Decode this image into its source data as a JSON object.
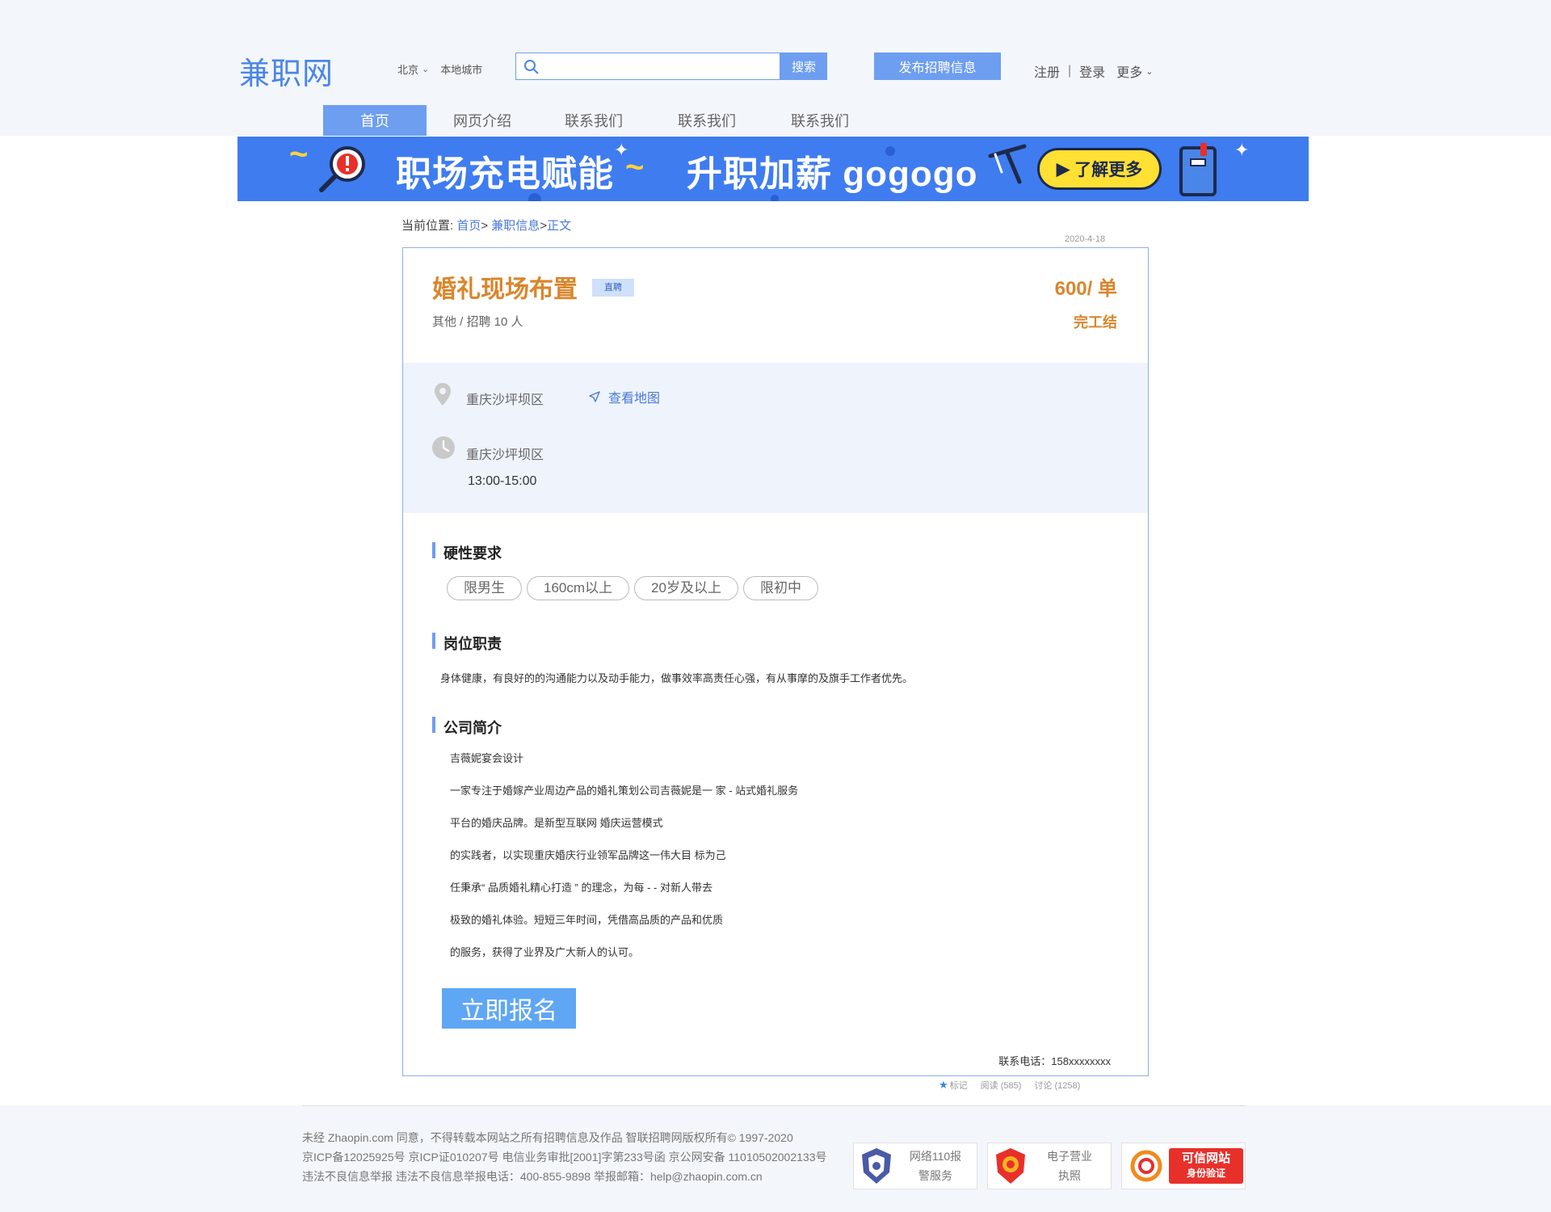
{
  "header": {
    "logo": "兼职网",
    "city": "北京",
    "local_city": "本地城市",
    "search": {
      "placeholder": "",
      "button": "搜索"
    },
    "post_button": "发布招聘信息",
    "register": "注册",
    "login": "登录",
    "more": "更多"
  },
  "nav": [
    {
      "label": "首页",
      "active": true
    },
    {
      "label": "网页介绍"
    },
    {
      "label": "联系我们"
    },
    {
      "label": "联系我们"
    },
    {
      "label": "联系我们"
    }
  ],
  "banner": {
    "text_left": "职场充电赋能",
    "text_right": "升职加薪 gogogo",
    "cta": "了解更多"
  },
  "breadcrumb": {
    "prefix": "当前位置: ",
    "home": "首页",
    "sep1": "> ",
    "category": "兼职信息",
    "sep2": ">",
    "current": "正文"
  },
  "date": "2020-4-18",
  "job": {
    "title": "婚礼现场布置",
    "tag": "直聘",
    "meta": "其他 / 招聘 10 人",
    "salary": "600/ 单",
    "settlement": "完工结",
    "location": "重庆沙坪坝区",
    "map_link": "查看地图",
    "work_location": "重庆沙坪坝区",
    "work_time": "13:00-15:00"
  },
  "requirements": {
    "heading": "硬性要求",
    "tags": [
      "限男生",
      "160cm以上",
      "20岁及以上",
      "限初中"
    ]
  },
  "duties": {
    "heading": "岗位职责",
    "text": "身体健康，有良好的的沟通能力以及动手能力，做事效率高责任心强，有从事摩的及旗手工作者优先。"
  },
  "company": {
    "heading": "公司简介",
    "lines": [
      "吉薇妮宴会设计",
      "一家专注于婚嫁产业周边产品的婚礼策划公司吉薇妮是一 家 - 站式婚礼服务",
      "平台的婚庆品牌。是新型互联网 婚庆运营模式",
      "的实践者，以实现重庆婚庆行业领军品牌这一伟大目 标为己",
      "任秉承“ 品质婚礼精心打造 ” 的理念，为每 - - 对新人带去",
      "极致的婚礼体验。短短三年时间，凭借高品质的产品和优质",
      "的服务，获得了业界及广大新人的认可。"
    ]
  },
  "apply_button": "立即报名",
  "phone": "联系电话：158xxxxxxxx",
  "stats": {
    "mark": "标记",
    "read": "阅读 (585)",
    "discuss": "讨论 (1258)"
  },
  "footer": {
    "line1": "未经 Zhaopin.com 同意，不得转载本网站之所有招聘信息及作品 智联招聘网版权所有© 1997-2020",
    "line2": "京ICP备12025925号 京ICP证010207号 电信业务审批[2001]字第233号函 京公网安备 11010502002133号",
    "line3": "违法不良信息举报 违法不良信息举报电话：400-855-9898 举报邮箱：help@zhaopin.com.cn",
    "badge1": [
      "网络110报",
      "警服务"
    ],
    "badge2": [
      "电子营业",
      "执照"
    ],
    "badge3": [
      "可信网站",
      "身份验证"
    ]
  },
  "colors": {
    "accent": "#6d9ef0",
    "orange": "#d9862c",
    "panel": "#eef3fc",
    "banner": "#3f7cf0",
    "cta_yellow": "#ffe033"
  }
}
